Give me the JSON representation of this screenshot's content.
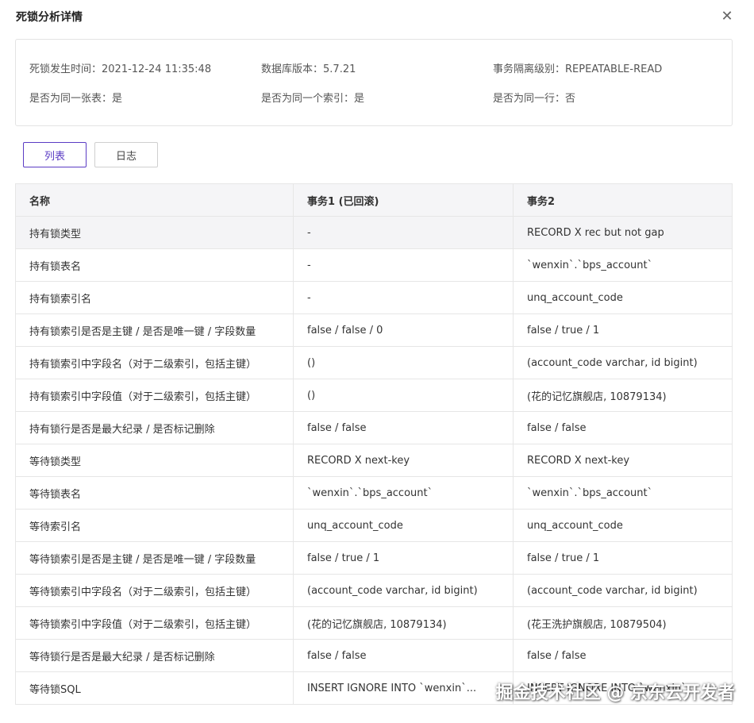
{
  "dialog": {
    "title": "死锁分析详情",
    "close_icon": "close-icon"
  },
  "info": {
    "occur_time_label": "死锁发生时间：",
    "occur_time_value": "2021-12-24 11:35:48",
    "db_version_label": "数据库版本：",
    "db_version_value": "5.7.21",
    "isolation_label": "事务隔离级别：",
    "isolation_value": "REPEATABLE-READ",
    "same_table_label": "是否为同一张表：",
    "same_table_value": "是",
    "same_index_label": "是否为同一个索引：",
    "same_index_value": "是",
    "same_row_label": "是否为同一行：",
    "same_row_value": "否"
  },
  "tabs": [
    {
      "label": "列表",
      "active": true
    },
    {
      "label": "日志",
      "active": false
    }
  ],
  "table": {
    "headers": [
      "名称",
      "事务1 (已回滚)",
      "事务2"
    ],
    "rows": [
      [
        "持有锁类型",
        "-",
        "RECORD X rec but not gap"
      ],
      [
        "持有锁表名",
        "-",
        "`wenxin`.`bps_account`"
      ],
      [
        "持有锁索引名",
        "-",
        "unq_account_code"
      ],
      [
        "持有锁索引是否是主键 / 是否是唯一键 / 字段数量",
        "false / false / 0",
        "false / true / 1"
      ],
      [
        "持有锁索引中字段名（对于二级索引，包括主键）",
        "()",
        "(account_code varchar, id bigint)"
      ],
      [
        "持有锁索引中字段值（对于二级索引，包括主键）",
        "()",
        "(花的记忆旗舰店, 10879134)"
      ],
      [
        "持有锁行是否是最大纪录 / 是否标记删除",
        "false / false",
        "false / false"
      ],
      [
        "等待锁类型",
        "RECORD X next-key",
        "RECORD X next-key"
      ],
      [
        "等待锁表名",
        "`wenxin`.`bps_account`",
        "`wenxin`.`bps_account`"
      ],
      [
        "等待索引名",
        "unq_account_code",
        "unq_account_code"
      ],
      [
        "等待锁索引是否是主键 / 是否是唯一键 / 字段数量",
        "false / true / 1",
        "false / true / 1"
      ],
      [
        "等待锁索引中字段名（对于二级索引，包括主键）",
        "(account_code varchar, id bigint)",
        "(account_code varchar, id bigint)"
      ],
      [
        "等待锁索引中字段值（对于二级索引，包括主键）",
        "(花的记忆旗舰店, 10879134)",
        "(花王洗护旗舰店, 10879504)"
      ],
      [
        "等待锁行是否是最大纪录 / 是否标记删除",
        "false / false",
        "false / false"
      ],
      [
        "等待锁SQL",
        "INSERT IGNORE INTO `wenxin`...",
        "INSERT IGNORE INTO `wenxin`..."
      ]
    ]
  },
  "watermark": "掘金技术社区 @ 京东云开发者",
  "colors": {
    "accent": "#5b3cc4",
    "border": "#e6e6e6",
    "header_bg": "#f5f5f7"
  }
}
